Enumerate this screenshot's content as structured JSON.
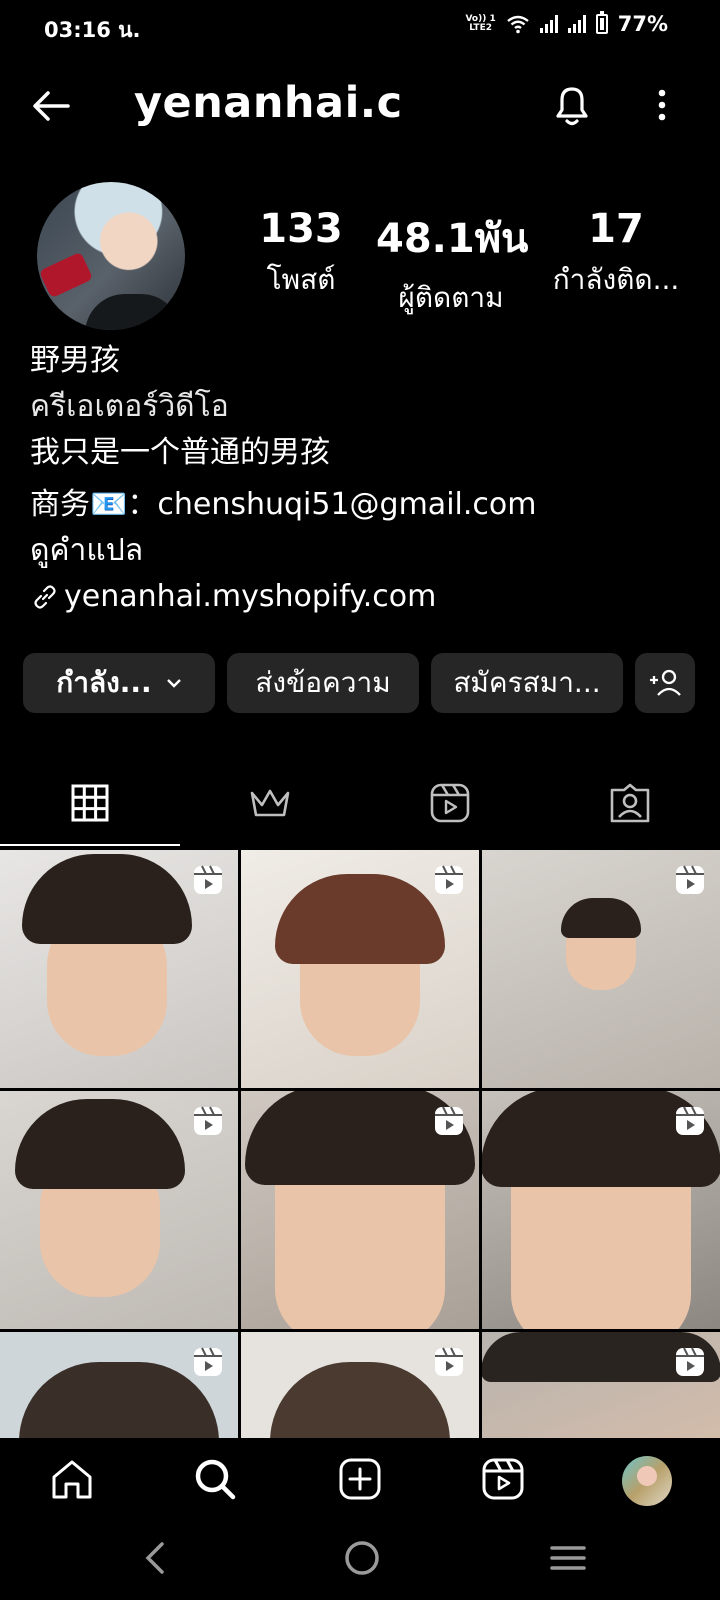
{
  "status_bar": {
    "time": "03:16 น.",
    "volte_top": "Vo)) 1",
    "volte_bottom": "LTE2",
    "battery": "77%"
  },
  "header": {
    "username": "yenanhai.c"
  },
  "stats": {
    "posts": {
      "value": "133",
      "label": "โพสต์"
    },
    "followers": {
      "value": "48.1พัน",
      "label": "ผู้ติดตาม"
    },
    "following": {
      "value": "17",
      "label": "กำลังติด..."
    }
  },
  "bio": {
    "name": "野男孩",
    "category": "ครีเอเตอร์วิดีโอ",
    "line1": "我只是一个普通的男孩",
    "line2": "商务📧：chenshuqi51@gmail.com",
    "translate": "ดูคำแปล",
    "link": "yenanhai.myshopify.com"
  },
  "actions": {
    "following": "กำลัง...",
    "message": "ส่งข้อความ",
    "subscribe": "สมัครสมา..."
  },
  "tabs": [
    "grid-icon",
    "crown-icon",
    "reels-icon",
    "tagged-icon"
  ],
  "grid": {
    "rows_visible": 3,
    "cols": 3,
    "reel_badge_icon": "reels-icon"
  },
  "bottom_nav": [
    "home-icon",
    "search-icon",
    "create-icon",
    "reels-icon",
    "profile-avatar"
  ],
  "system_nav": [
    "back-icon",
    "home-circle-icon",
    "recents-icon"
  ],
  "colors": {
    "background": "#000000",
    "button": "#262626",
    "text": "#ffffff"
  }
}
